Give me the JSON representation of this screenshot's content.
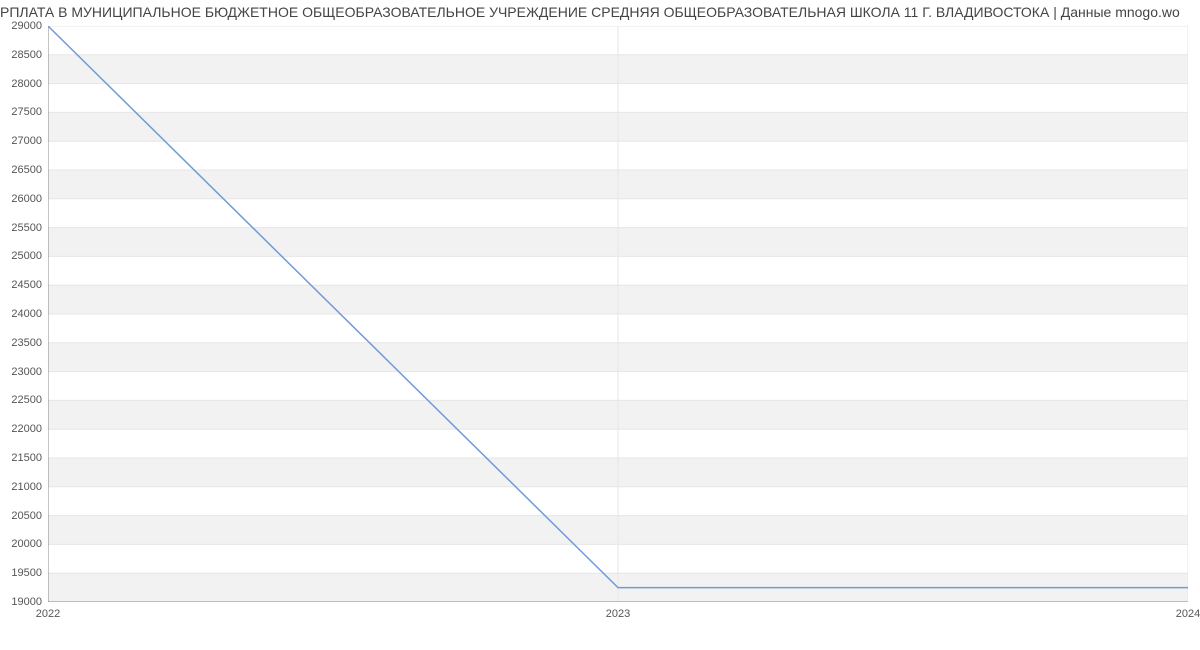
{
  "title": "РПЛАТА В МУНИЦИПАЛЬНОЕ БЮДЖЕТНОЕ ОБЩЕОБРАЗОВАТЕЛЬНОЕ УЧРЕЖДЕНИЕ СРЕДНЯЯ ОБЩЕОБРАЗОВАТЕЛЬНАЯ ШКОЛА 11 Г. ВЛАДИВОСТОКА | Данные mnogo.wo",
  "chart_data": {
    "type": "line",
    "x": [
      2022,
      2023,
      2024
    ],
    "y": [
      29000,
      19250,
      19250
    ],
    "xlabel": "",
    "ylabel": "",
    "xlim": [
      2022,
      2024
    ],
    "ylim": [
      19000,
      29000
    ],
    "yticks": [
      19000,
      19500,
      20000,
      20500,
      21000,
      21500,
      22000,
      22500,
      23000,
      23500,
      24000,
      24500,
      25000,
      25500,
      26000,
      26500,
      27000,
      27500,
      28000,
      28500,
      29000
    ],
    "xticks": [
      2022,
      2023,
      2024
    ],
    "grid": true
  }
}
